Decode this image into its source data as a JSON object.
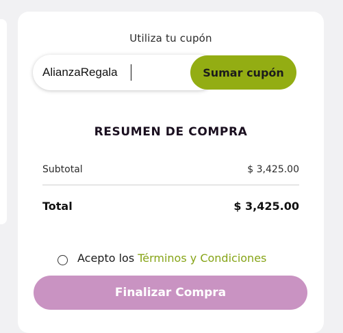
{
  "coupon": {
    "title": "Utiliza tu cupón",
    "input_value": "AlianzaRegala",
    "button_label": "Sumar cupón"
  },
  "summary": {
    "title": "RESUMEN DE COMPRA",
    "subtotal_label": "Subtotal",
    "subtotal_value": "$ 3,425.00",
    "total_label": "Total",
    "total_value": "$ 3,425.00"
  },
  "terms": {
    "text": "Acepto los",
    "link_label": "Términos y Condiciones"
  },
  "checkout": {
    "button_label": "Finalizar Compra"
  },
  "colors": {
    "accent_green": "#93ad13",
    "link_green": "#86a417",
    "finalize_pink": "#c993c2"
  }
}
